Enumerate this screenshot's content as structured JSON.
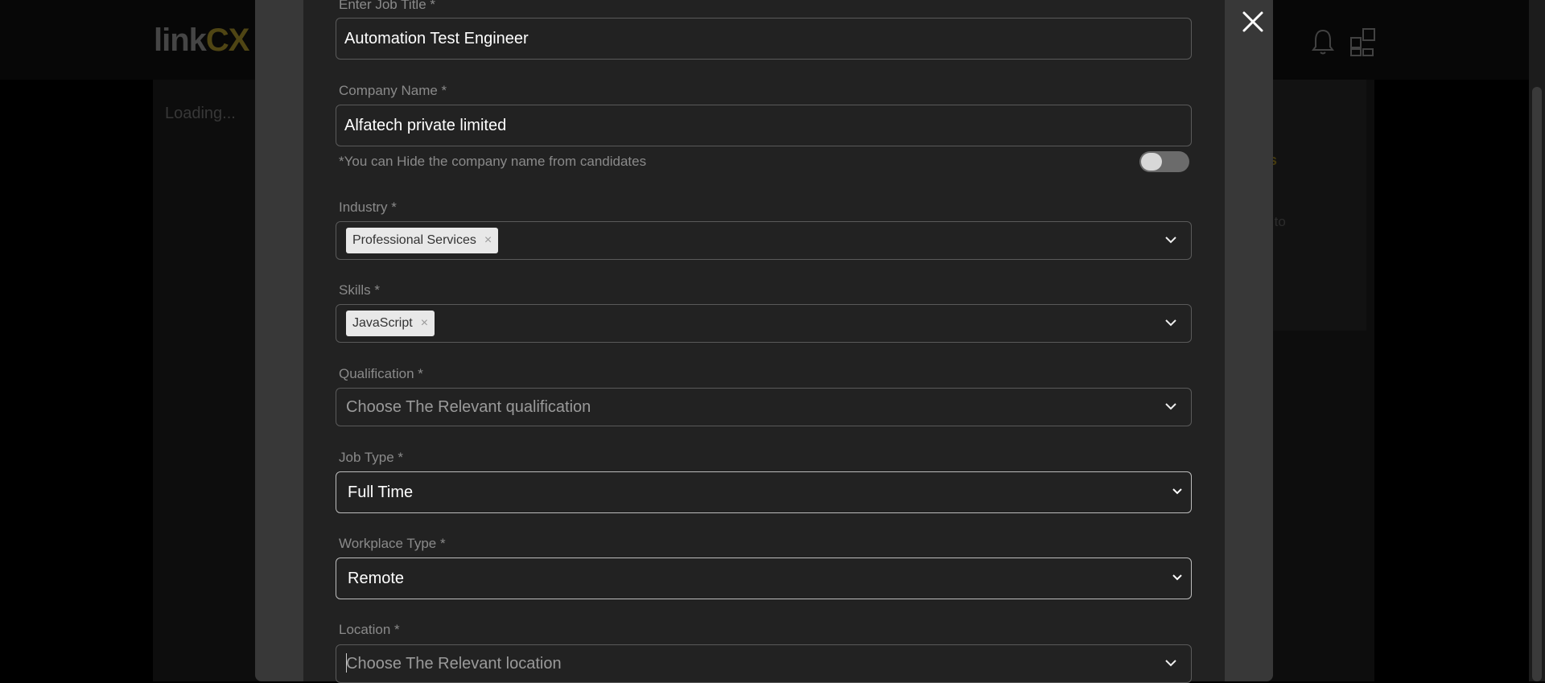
{
  "background": {
    "logo_text_1": "link",
    "logo_text_2": "CX",
    "loading_text": "Loading...",
    "card_link_fragment": "ers",
    "card_text_fragment": "up to"
  },
  "form": {
    "job_title": {
      "label": "Enter Job Title *",
      "value": "Automation Test Engineer"
    },
    "company_name": {
      "label": "Company Name *",
      "value": "Alfatech private limited",
      "hide_hint": "*You can Hide the company name from candidates",
      "hide_toggle_on": false
    },
    "industry": {
      "label": "Industry *",
      "tags": [
        "Professional Services"
      ]
    },
    "skills": {
      "label": "Skills *",
      "tags": [
        "JavaScript"
      ]
    },
    "qualification": {
      "label": "Qualification *",
      "placeholder": "Choose The Relevant qualification"
    },
    "job_type": {
      "label": "Job Type *",
      "value": "Full Time"
    },
    "workplace_type": {
      "label": "Workplace Type *",
      "value": "Remote"
    },
    "location": {
      "label": "Location *",
      "placeholder": "Choose The Relevant location"
    }
  },
  "icons": {
    "close": "close-icon",
    "notifications": "bell-icon",
    "apps": "apps-grid-icon",
    "dropdown": "chevron-down-icon",
    "tag_remove": "×"
  },
  "colors": {
    "page_bg": "#000000",
    "modal_frame": "#383838",
    "modal_body": "#222222",
    "field_border": "#5a5a5a",
    "label_text": "#8a8a8a",
    "logo_accent": "#7a6a20"
  }
}
